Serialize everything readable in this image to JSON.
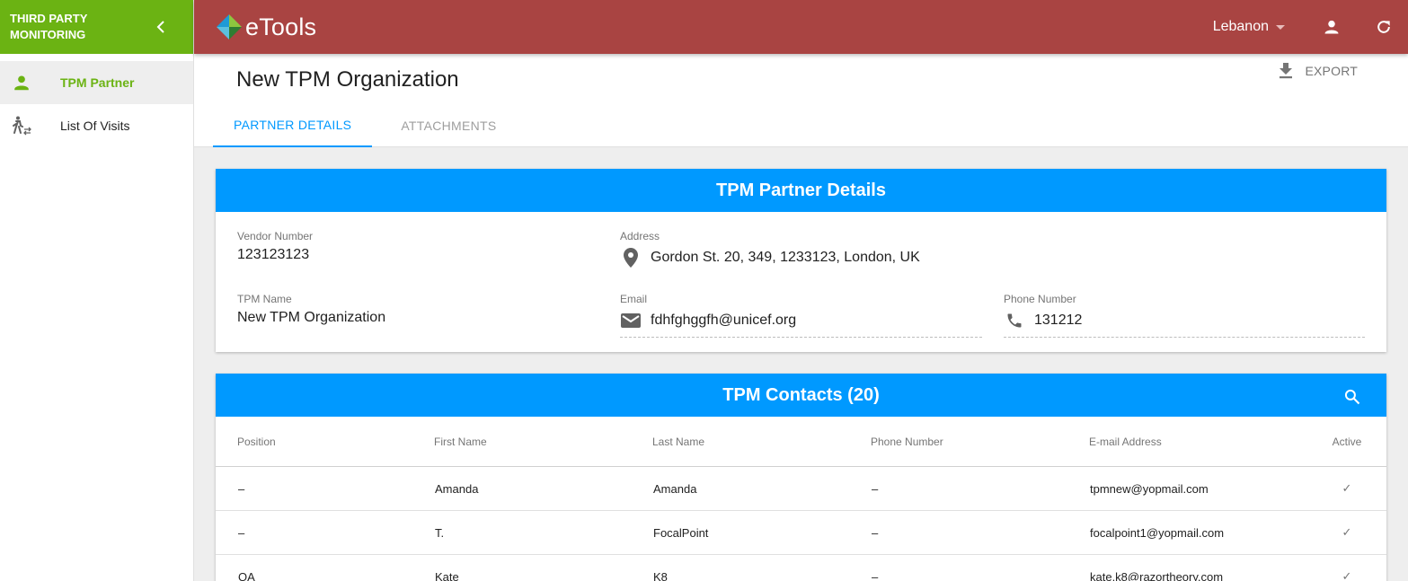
{
  "sidebar": {
    "title": "THIRD PARTY MONITORING",
    "items": [
      {
        "label": "TPM Partner",
        "icon": "person-icon",
        "active": true
      },
      {
        "label": "List Of Visits",
        "icon": "walking-person-icon",
        "active": false
      }
    ]
  },
  "topbar": {
    "logo_text": "eTools",
    "country": "Lebanon"
  },
  "page": {
    "title": "New TPM Organization",
    "export_label": "EXPORT",
    "tabs": [
      {
        "label": "PARTNER DETAILS",
        "active": true
      },
      {
        "label": "ATTACHMENTS",
        "active": false
      }
    ]
  },
  "details": {
    "header": "TPM Partner Details",
    "vendor_number_label": "Vendor Number",
    "vendor_number": "123123123",
    "address_label": "Address",
    "address": "Gordon St. 20, 349, 1233123, London, UK",
    "tpm_name_label": "TPM Name",
    "tpm_name": "New TPM Organization",
    "email_label": "Email",
    "email": "fdhfghggfh@unicef.org",
    "phone_label": "Phone Number",
    "phone": "131212"
  },
  "contacts": {
    "header": "TPM Contacts (20)",
    "columns": {
      "position": "Position",
      "first_name": "First Name",
      "last_name": "Last Name",
      "phone": "Phone Number",
      "email": "E-mail Address",
      "active": "Active"
    },
    "rows": [
      {
        "position": "–",
        "first_name": "Amanda",
        "last_name": "Amanda",
        "phone": "–",
        "email": "tpmnew@yopmail.com",
        "active": "✓"
      },
      {
        "position": "–",
        "first_name": "T.",
        "last_name": "FocalPoint",
        "phone": "–",
        "email": "focalpoint1@yopmail.com",
        "active": "✓"
      },
      {
        "position": "QA",
        "first_name": "Kate",
        "last_name": "K8",
        "phone": "–",
        "email": "kate.k8@razortheory.com",
        "active": "✓"
      }
    ]
  },
  "colors": {
    "sidebar_accent": "#6bb313",
    "topbar": "#a94442",
    "primary_blue": "#0099ff"
  }
}
